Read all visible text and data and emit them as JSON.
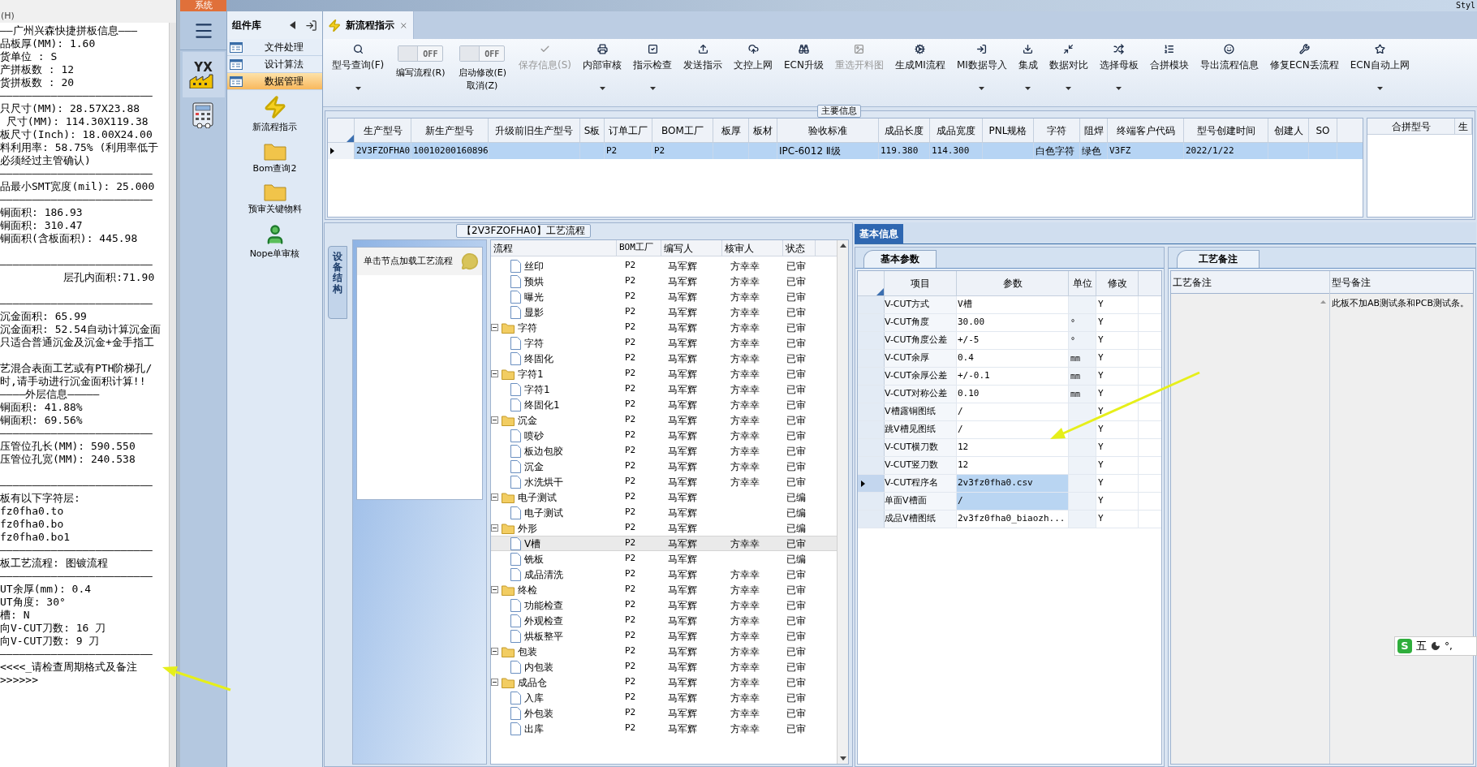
{
  "text_editor": {
    "menu_item": "(H)",
    "blocks": [
      [
        "——广州兴森快捷拼板信息———",
        "品板厚(MM): 1.60",
        "货单位 : S",
        "产拼板数 : 12",
        "货拼板数 : 20",
        "————————————————————————",
        "只尺寸(MM): 28.57X23.88",
        " 尺寸(MM): 114.30X119.38",
        "板尺寸(Inch): 18.00X24.00",
        "料利用率: 58.75% (利用率低于",
        "必须经过主管确认)",
        "————————————————————————",
        "品最小SMT宽度(mil): 25.000",
        "————————————————————————",
        "铜面积: 186.93",
        "铜面积: 310.47",
        "铜面积(含板面积): 445.98"
      ],
      [
        "————————————————————————",
        "          层孔内面积:71.90"
      ],
      [
        "————————————————————————",
        "沉金面积: 65.99",
        "沉金面积: 52.54自动计算沉金面",
        "只适合普通沉金及沉金+金手指工"
      ],
      [
        "艺混合表面工艺或有PTH阶梯孔/",
        "时,请手动进行沉金面积计算!!",
        "————外层信息—————",
        "铜面积: 41.88%",
        "铜面积: 69.56%",
        "————————————————————————",
        "压管位孔长(MM): 590.550",
        "压管位孔宽(MM): 240.538"
      ],
      [
        "————————————————————————",
        "板有以下字符层:",
        "fz0fha0.to",
        "fz0fha0.bo",
        "fz0fha0.bo1",
        "————————————————————————",
        "板工艺流程: 图镀流程",
        "————————————————————————",
        "UT余厚(mm): 0.4",
        "UT角度: 30°",
        "槽: N",
        "向V-CUT刀数: 16 刀",
        "向V-CUT刀数: 9 刀",
        "————————————————————————",
        "<<<<_请检查周期格式及备注",
        ">>>>>>"
      ]
    ]
  },
  "top_bar": {
    "system_tab": "系统",
    "corner_text": "Styl"
  },
  "logo": "YX",
  "component_panel": {
    "title": "组件库",
    "items": [
      {
        "label": "文件处理",
        "selected": false
      },
      {
        "label": "设计算法",
        "selected": false
      },
      {
        "label": "数据管理",
        "selected": true
      }
    ],
    "tools": [
      {
        "label": "新流程指示"
      },
      {
        "label": "Bom查询2"
      },
      {
        "label": "预审关键物料"
      },
      {
        "label": "Nope单审核"
      }
    ]
  },
  "document_tab": {
    "title": "新流程指示"
  },
  "toolbar": {
    "items": [
      {
        "kind": "button",
        "label": "型号查询(F)",
        "disabled": false,
        "dropdown": true
      },
      {
        "kind": "toggle",
        "label": "编写流程(R)",
        "state_label": "OFF",
        "on": false
      },
      {
        "kind": "toggle",
        "label": "启动修改(E)",
        "sublabel": "取消(Z)",
        "state_label": "OFF",
        "on": false
      },
      {
        "kind": "button",
        "label": "保存信息(S)",
        "disabled": true,
        "dropdown": false
      },
      {
        "kind": "button",
        "label": "内部审核",
        "disabled": false,
        "dropdown": true
      },
      {
        "kind": "button",
        "label": "指示检查",
        "disabled": false,
        "dropdown": true
      },
      {
        "kind": "button",
        "label": "发送指示",
        "disabled": false,
        "dropdown": false
      },
      {
        "kind": "button",
        "label": "文控上网",
        "disabled": false,
        "dropdown": false
      },
      {
        "kind": "button",
        "label": "ECN升级",
        "disabled": false,
        "dropdown": false
      },
      {
        "kind": "button",
        "label": "重选开料图",
        "disabled": true,
        "dropdown": false
      },
      {
        "kind": "button",
        "label": "生成MI流程",
        "disabled": false,
        "dropdown": false
      },
      {
        "kind": "button",
        "label": "MI数据导入",
        "disabled": false,
        "dropdown": true
      },
      {
        "kind": "button",
        "label": "集成",
        "disabled": false,
        "dropdown": true
      },
      {
        "kind": "button",
        "label": "数据对比",
        "disabled": false,
        "dropdown": true
      },
      {
        "kind": "button",
        "label": "选择母板",
        "disabled": false,
        "dropdown": true
      },
      {
        "kind": "button",
        "label": "合拼模块",
        "disabled": false,
        "dropdown": false
      },
      {
        "kind": "button",
        "label": "导出流程信息",
        "disabled": false,
        "dropdown": false
      },
      {
        "kind": "button",
        "label": "修复ECN丢流程",
        "disabled": false,
        "dropdown": false
      },
      {
        "kind": "button",
        "label": "ECN自动上网",
        "disabled": false,
        "dropdown": true
      }
    ]
  },
  "main_info": {
    "title": "主要信息",
    "columns": [
      "生产型号",
      "新生产型号",
      "升级前旧生产型号",
      "S板",
      "订单工厂",
      "BOM工厂",
      "板厚",
      "板材",
      "验收标准",
      "成品长度",
      "成品宽度",
      "PNL规格",
      "字符",
      "阻焊",
      "终端客户代码",
      "型号创建时间",
      "创建人",
      "SO"
    ],
    "rows": [
      {
        "selected": true,
        "cells": [
          "2V3FZOFHA0",
          "10010200160896",
          null,
          null,
          "P2",
          "P2",
          null,
          null,
          "IPC-6012 Ⅱ级",
          "119.380",
          "114.300",
          null,
          "白色字符",
          "绿色",
          "V3FZ",
          "2022/1/22",
          null,
          null
        ]
      }
    ],
    "side_columns": [
      "合拼型号",
      "生"
    ]
  },
  "process_panel": {
    "title": "【2V3FZOFHA0】工艺流程",
    "side_tab": "设备结构",
    "hint": "单击节点加载工艺流程",
    "columns": [
      "流程",
      "BOM工厂",
      "编写人",
      "核审人",
      "状态"
    ],
    "nodes": [
      {
        "children": [
          {
            "label": "丝印",
            "bom": "P2",
            "writer": "马军辉",
            "reviewer": "方幸幸",
            "status": "已审",
            "selected": false
          },
          {
            "label": "预烘",
            "bom": "P2",
            "writer": "马军辉",
            "reviewer": "方幸幸",
            "status": "已审",
            "selected": false
          },
          {
            "label": "曝光",
            "bom": "P2",
            "writer": "马军辉",
            "reviewer": "方幸幸",
            "status": "已审",
            "selected": false
          },
          {
            "label": "显影",
            "bom": "P2",
            "writer": "马军辉",
            "reviewer": "方幸幸",
            "status": "已审",
            "selected": false
          }
        ]
      },
      {
        "label": "字符",
        "bom": "P2",
        "writer": "马军辉",
        "reviewer": "方幸幸",
        "status": "已审",
        "selected": false,
        "expanded": true,
        "children": [
          {
            "label": "字符",
            "bom": "P2",
            "writer": "马军辉",
            "reviewer": "方幸幸",
            "status": "已审",
            "selected": false
          },
          {
            "label": "终固化",
            "bom": "P2",
            "writer": "马军辉",
            "reviewer": "方幸幸",
            "status": "已审",
            "selected": false
          }
        ]
      },
      {
        "label": "字符1",
        "bom": "P2",
        "writer": "马军辉",
        "reviewer": "方幸幸",
        "status": "已审",
        "selected": false,
        "expanded": true,
        "children": [
          {
            "label": "字符1",
            "bom": "P2",
            "writer": "马军辉",
            "reviewer": "方幸幸",
            "status": "已审",
            "selected": false
          },
          {
            "label": "终固化1",
            "bom": "P2",
            "writer": "马军辉",
            "reviewer": "方幸幸",
            "status": "已审",
            "selected": false
          }
        ]
      },
      {
        "label": "沉金",
        "bom": "P2",
        "writer": "马军辉",
        "reviewer": "方幸幸",
        "status": "已审",
        "selected": false,
        "expanded": true,
        "children": [
          {
            "label": "喷砂",
            "bom": "P2",
            "writer": "马军辉",
            "reviewer": "方幸幸",
            "status": "已审",
            "selected": false
          },
          {
            "label": "板边包胶",
            "bom": "P2",
            "writer": "马军辉",
            "reviewer": "方幸幸",
            "status": "已审",
            "selected": false
          },
          {
            "label": "沉金",
            "bom": "P2",
            "writer": "马军辉",
            "reviewer": "方幸幸",
            "status": "已审",
            "selected": false
          },
          {
            "label": "水洗烘干",
            "bom": "P2",
            "writer": "马军辉",
            "reviewer": "方幸幸",
            "status": "已审",
            "selected": false
          }
        ]
      },
      {
        "label": "电子测试",
        "bom": "P2",
        "writer": "马军辉",
        "status": "已编",
        "selected": false,
        "expanded": true,
        "children": [
          {
            "label": "电子测试",
            "bom": "P2",
            "writer": "马军辉",
            "status": "已编",
            "selected": false
          }
        ]
      },
      {
        "label": "外形",
        "bom": "P2",
        "writer": "马军辉",
        "status": "已编",
        "selected": false,
        "expanded": true,
        "children": [
          {
            "label": "V槽",
            "bom": "P2",
            "writer": "马军辉",
            "reviewer": "方幸幸",
            "status": "已审",
            "selected": true
          },
          {
            "label": "铣板",
            "bom": "P2",
            "writer": "马军辉",
            "status": "已编",
            "selected": false
          },
          {
            "label": "成品清洗",
            "bom": "P2",
            "writer": "马军辉",
            "reviewer": "方幸幸",
            "status": "已审",
            "selected": false
          }
        ]
      },
      {
        "label": "终检",
        "bom": "P2",
        "writer": "马军辉",
        "reviewer": "方幸幸",
        "status": "已审",
        "selected": false,
        "expanded": true,
        "children": [
          {
            "label": "功能检查",
            "bom": "P2",
            "writer": "马军辉",
            "reviewer": "方幸幸",
            "status": "已审",
            "selected": false
          },
          {
            "label": "外观检查",
            "bom": "P2",
            "writer": "马军辉",
            "reviewer": "方幸幸",
            "status": "已审",
            "selected": false
          },
          {
            "label": "烘板整平",
            "bom": "P2",
            "writer": "马军辉",
            "reviewer": "方幸幸",
            "status": "已审",
            "selected": false
          }
        ]
      },
      {
        "label": "包装",
        "bom": "P2",
        "writer": "马军辉",
        "reviewer": "方幸幸",
        "status": "已审",
        "selected": false,
        "expanded": true,
        "children": [
          {
            "label": "内包装",
            "bom": "P2",
            "writer": "马军辉",
            "reviewer": "方幸幸",
            "status": "已审",
            "selected": false
          }
        ]
      },
      {
        "label": "成品仓",
        "bom": "P2",
        "writer": "马军辉",
        "reviewer": "方幸幸",
        "status": "已审",
        "selected": false,
        "expanded": true,
        "children": [
          {
            "label": "入库",
            "bom": "P2",
            "writer": "马军辉",
            "reviewer": "方幸幸",
            "status": "已审",
            "selected": false
          },
          {
            "label": "外包装",
            "bom": "P2",
            "writer": "马军辉",
            "reviewer": "方幸幸",
            "status": "已审",
            "selected": false
          },
          {
            "label": "出库",
            "bom": "P2",
            "writer": "马军辉",
            "reviewer": "方幸幸",
            "status": "已审",
            "selected": false
          }
        ]
      }
    ]
  },
  "basic_info": {
    "tab": "基本信息",
    "params_tab": "基本参数",
    "columns": [
      "项目",
      "参数",
      "单位",
      "修改"
    ],
    "rows": [
      {
        "item": "V-CUT方式",
        "value": "V槽",
        "modified": "Y",
        "selected": false,
        "highlighted": false
      },
      {
        "item": "V-CUT角度",
        "value": "30.00",
        "unit": "°",
        "modified": "Y",
        "selected": false,
        "highlighted": false
      },
      {
        "item": "V-CUT角度公差",
        "value": "+/-5",
        "unit": "°",
        "modified": "Y",
        "selected": false,
        "highlighted": false
      },
      {
        "item": "V-CUT余厚",
        "value": "0.4",
        "unit": "mm",
        "modified": "Y",
        "selected": false,
        "highlighted": false
      },
      {
        "item": "V-CUT余厚公差",
        "value": "+/-0.1",
        "unit": "mm",
        "modified": "Y",
        "selected": false,
        "highlighted": false
      },
      {
        "item": "V-CUT对称公差",
        "value": "0.10",
        "unit": "mm",
        "modified": "Y",
        "selected": false,
        "highlighted": false
      },
      {
        "item": "V槽露铜图纸",
        "value": "/",
        "modified": "Y",
        "selected": false,
        "highlighted": false
      },
      {
        "item": "跳V槽见图纸",
        "value": "/",
        "modified": "Y",
        "selected": false,
        "highlighted": false
      },
      {
        "item": "V-CUT横刀数",
        "value": "12",
        "modified": "Y",
        "selected": false,
        "highlighted": false
      },
      {
        "item": "V-CUT竖刀数",
        "value": "12",
        "modified": "Y",
        "selected": false,
        "highlighted": false
      },
      {
        "item": "V-CUT程序名",
        "value": "2v3fz0fha0.csv",
        "modified": "Y",
        "selected": true,
        "highlighted": true
      },
      {
        "item": "单面V槽面",
        "value": "/",
        "modified": "Y",
        "selected": false,
        "highlighted": true
      },
      {
        "item": "成品V槽图纸",
        "value": "2v3fz0fha0_biaozh...",
        "modified": "Y",
        "selected": false,
        "highlighted": false
      }
    ],
    "notes_tab": "工艺备注",
    "notes_columns": [
      "工艺备注",
      "型号备注"
    ],
    "model_note": "此板不加AB测试条和PCB测试条。"
  },
  "ime": {
    "logo": "S",
    "mode": "五",
    "punct": "°,"
  }
}
